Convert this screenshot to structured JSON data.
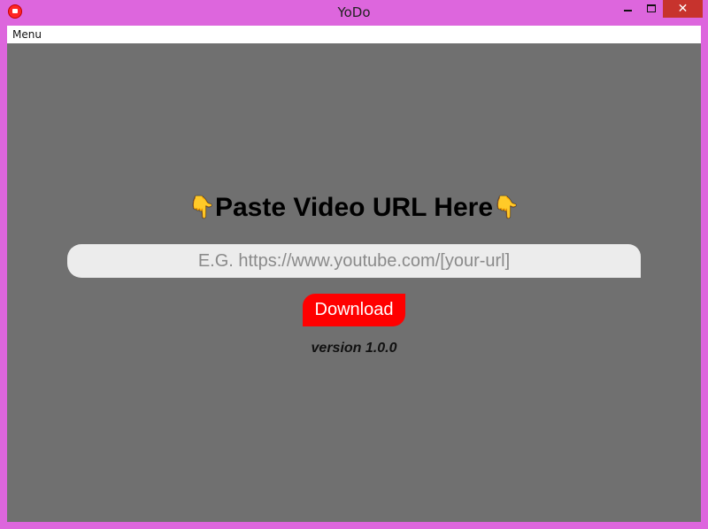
{
  "window": {
    "title": "YoDo",
    "controls": {
      "minimize": "",
      "maximize": "",
      "close": "✕"
    },
    "icon": "yodo-app-icon"
  },
  "menubar": {
    "items": [
      {
        "label": "Menu"
      }
    ]
  },
  "main": {
    "heading": "Paste Video URL Here",
    "heading_icon_left": "👇",
    "heading_icon_right": "👇",
    "url_input": {
      "value": "",
      "placeholder": "E.G. https://www.youtube.com/[your-url]"
    },
    "download_label": "Download",
    "version": "version 1.0.0"
  },
  "colors": {
    "window_border": "#dd66dd",
    "content_bg": "#707070",
    "input_bg": "#ececec",
    "download_bg": "#ff0000",
    "close_bg": "#c7332d"
  }
}
